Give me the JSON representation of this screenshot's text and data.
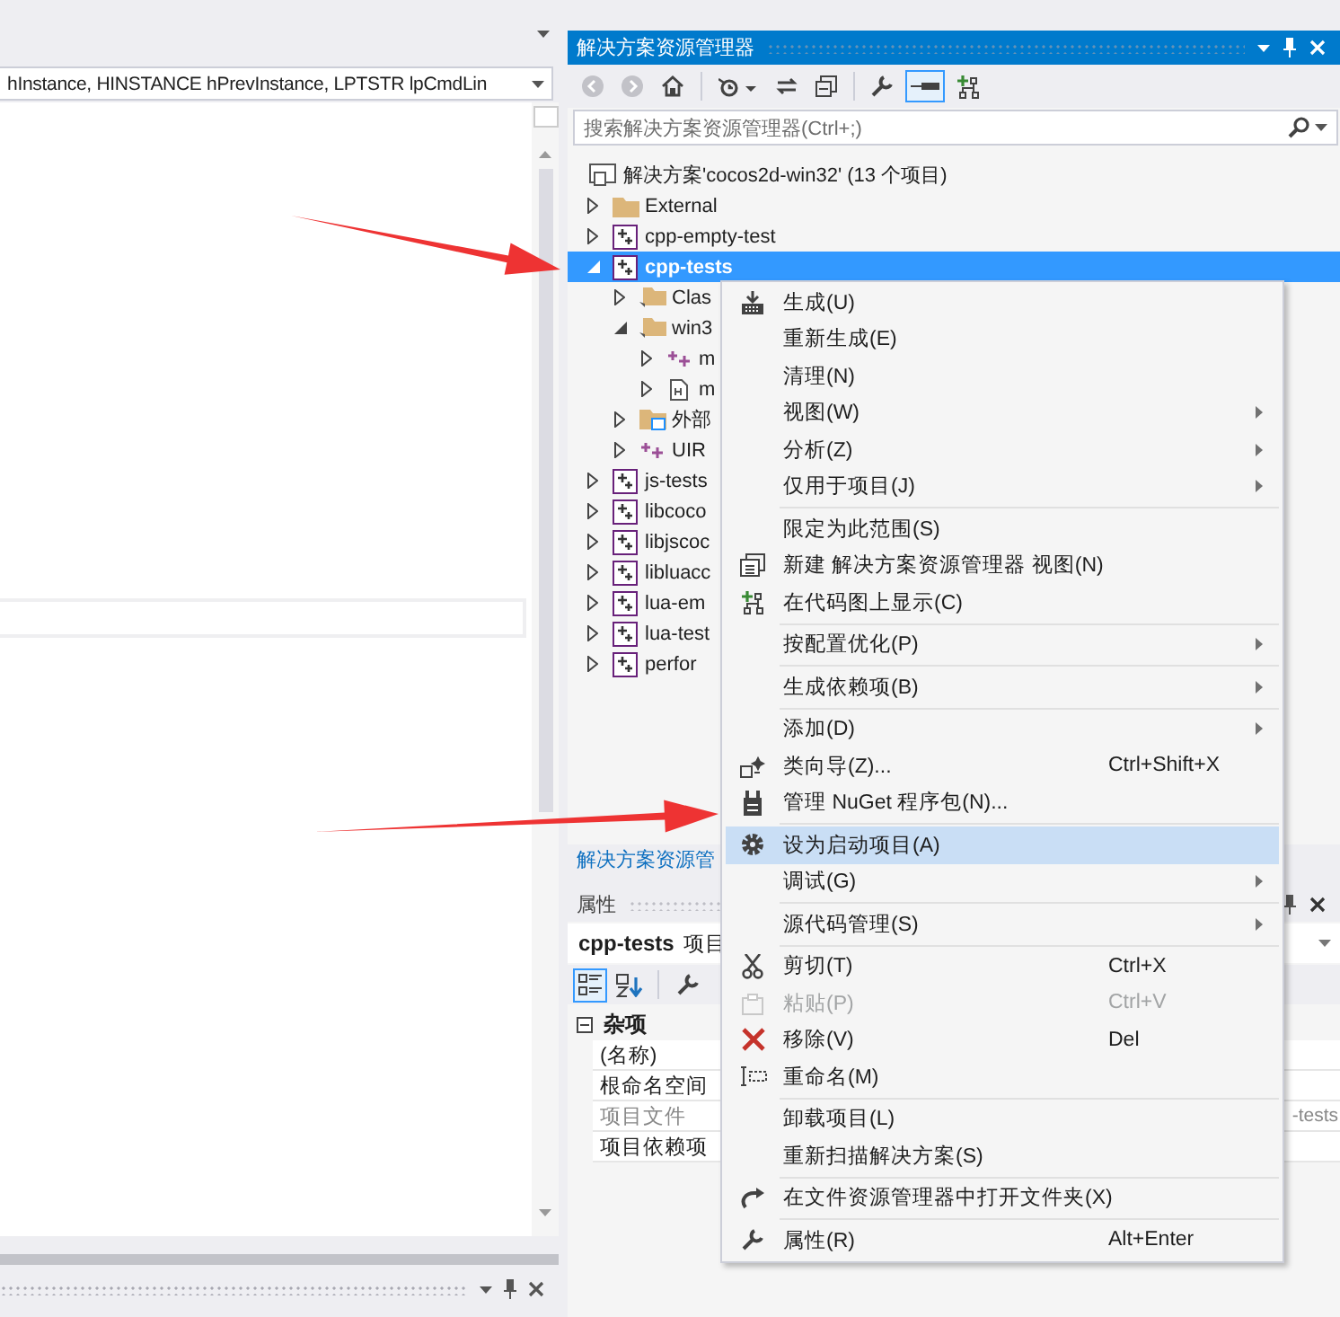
{
  "editor": {
    "nav_value": "hInstance, HINSTANCE hPrevInstance, LPTSTR lpCmdLin"
  },
  "solution_explorer": {
    "title": "解决方案资源管理器",
    "active": true,
    "toolbar": [
      {
        "disabled": true,
        "pressed": false
      },
      {
        "disabled": true,
        "pressed": false
      },
      {
        "disabled": false,
        "pressed": false
      },
      {
        "disabled": false,
        "pressed": false
      },
      {
        "disabled": false,
        "pressed": false
      },
      {
        "disabled": false,
        "pressed": false
      },
      {
        "disabled": false,
        "pressed": false
      },
      {
        "disabled": false,
        "pressed": true
      },
      {
        "disabled": false,
        "pressed": false
      }
    ],
    "search": {
      "placeholder": "搜索解决方案资源管理器(Ctrl+;)"
    },
    "solution": {
      "label": "解决方案'cocos2d-win32' (13 个项目)",
      "selected": false
    },
    "items": [
      {
        "label": "External",
        "kind": "folder",
        "selected": false,
        "expanded": false
      },
      {
        "label": "cpp-empty-test",
        "kind": "project",
        "selected": false,
        "expanded": false
      },
      {
        "label": "cpp-tests",
        "kind": "project",
        "selected": true,
        "expanded": true,
        "children": [
          {
            "label": "Clas",
            "kind": "filter",
            "selected": false,
            "expanded": false
          },
          {
            "label": "win3",
            "kind": "filter",
            "selected": false,
            "expanded": true,
            "children": [
              {
                "label": "m",
                "kind": "source",
                "selected": false,
                "expanded": false
              },
              {
                "label": "m",
                "kind": "header",
                "selected": false,
                "expanded": false
              }
            ]
          },
          {
            "label": "外部",
            "kind": "external",
            "selected": false,
            "expanded": false
          },
          {
            "label": "UIR",
            "kind": "source",
            "selected": false,
            "expanded": false
          }
        ]
      },
      {
        "label": "js-tests",
        "kind": "project",
        "selected": false,
        "expanded": false
      },
      {
        "label": "libcoco",
        "kind": "project",
        "selected": false,
        "expanded": false
      },
      {
        "label": "libjscoc",
        "kind": "project",
        "selected": false,
        "expanded": false
      },
      {
        "label": "libluacc",
        "kind": "project",
        "selected": false,
        "expanded": false
      },
      {
        "label": "lua-em",
        "kind": "project",
        "selected": false,
        "expanded": false
      },
      {
        "label": "lua-test",
        "kind": "project",
        "selected": false,
        "expanded": false
      },
      {
        "label": "perfor",
        "kind": "project",
        "selected": false,
        "expanded": false
      }
    ],
    "footer_tab": "解决方案资源管"
  },
  "properties": {
    "title": "属性",
    "active": false,
    "object_name": "cpp-tests",
    "object_type": "项目",
    "toolbar": [
      {
        "pressed": true
      },
      {
        "pressed": false
      },
      {
        "pressed": false
      }
    ],
    "category": {
      "label": "杂项",
      "expanded": true
    },
    "rows": [
      {
        "name": "(名称)",
        "disabled": false
      },
      {
        "name": "根命名空间",
        "disabled": false
      },
      {
        "name": "项目文件",
        "disabled": true,
        "value": "-tests"
      },
      {
        "name": "项目依赖项",
        "disabled": false
      }
    ]
  },
  "context_menu": {
    "items": [
      {
        "kind": "item",
        "label": "生成(U)",
        "selected": false,
        "disabled": false,
        "submenu": false
      },
      {
        "kind": "item",
        "label": "重新生成(E)",
        "selected": false,
        "disabled": false,
        "submenu": false
      },
      {
        "kind": "item",
        "label": "清理(N)",
        "selected": false,
        "disabled": false,
        "submenu": false
      },
      {
        "kind": "item",
        "label": "视图(W)",
        "selected": false,
        "disabled": false,
        "submenu": true
      },
      {
        "kind": "item",
        "label": "分析(Z)",
        "selected": false,
        "disabled": false,
        "submenu": true
      },
      {
        "kind": "item",
        "label": "仅用于项目(J)",
        "selected": false,
        "disabled": false,
        "submenu": true
      },
      {
        "kind": "separator"
      },
      {
        "kind": "item",
        "label": "限定为此范围(S)",
        "selected": false,
        "disabled": false,
        "submenu": false
      },
      {
        "kind": "item",
        "label": "新建 解决方案资源管理器 视图(N)",
        "selected": false,
        "disabled": false,
        "submenu": false
      },
      {
        "kind": "item",
        "label": "在代码图上显示(C)",
        "selected": false,
        "disabled": false,
        "submenu": false
      },
      {
        "kind": "separator"
      },
      {
        "kind": "item",
        "label": "按配置优化(P)",
        "selected": false,
        "disabled": false,
        "submenu": true
      },
      {
        "kind": "separator"
      },
      {
        "kind": "item",
        "label": "生成依赖项(B)",
        "selected": false,
        "disabled": false,
        "submenu": true
      },
      {
        "kind": "separator"
      },
      {
        "kind": "item",
        "label": "添加(D)",
        "selected": false,
        "disabled": false,
        "submenu": true
      },
      {
        "kind": "item",
        "label": "类向导(Z)...",
        "shortcut": "Ctrl+Shift+X",
        "selected": false,
        "disabled": false,
        "submenu": false
      },
      {
        "kind": "item",
        "label": "管理 NuGet 程序包(N)...",
        "selected": false,
        "disabled": false,
        "submenu": false
      },
      {
        "kind": "separator"
      },
      {
        "kind": "item",
        "label": "设为启动项目(A)",
        "selected": true,
        "disabled": false,
        "submenu": false
      },
      {
        "kind": "item",
        "label": "调试(G)",
        "selected": false,
        "disabled": false,
        "submenu": true
      },
      {
        "kind": "separator"
      },
      {
        "kind": "item",
        "label": "源代码管理(S)",
        "selected": false,
        "disabled": false,
        "submenu": true
      },
      {
        "kind": "separator"
      },
      {
        "kind": "item",
        "label": "剪切(T)",
        "shortcut": "Ctrl+X",
        "selected": false,
        "disabled": false,
        "submenu": false
      },
      {
        "kind": "item",
        "label": "粘贴(P)",
        "shortcut": "Ctrl+V",
        "selected": false,
        "disabled": true,
        "submenu": false
      },
      {
        "kind": "item",
        "label": "移除(V)",
        "shortcut": "Del",
        "selected": false,
        "disabled": false,
        "submenu": false
      },
      {
        "kind": "item",
        "label": "重命名(M)",
        "selected": false,
        "disabled": false,
        "submenu": false
      },
      {
        "kind": "separator"
      },
      {
        "kind": "item",
        "label": "卸载项目(L)",
        "selected": false,
        "disabled": false,
        "submenu": false
      },
      {
        "kind": "item",
        "label": "重新扫描解决方案(S)",
        "selected": false,
        "disabled": false,
        "submenu": false
      },
      {
        "kind": "separator"
      },
      {
        "kind": "item",
        "label": "在文件资源管理器中打开文件夹(X)",
        "selected": false,
        "disabled": false,
        "submenu": false
      },
      {
        "kind": "separator"
      },
      {
        "kind": "item",
        "label": "属性(R)",
        "shortcut": "Alt+Enter",
        "selected": false,
        "disabled": false,
        "submenu": false
      }
    ]
  }
}
